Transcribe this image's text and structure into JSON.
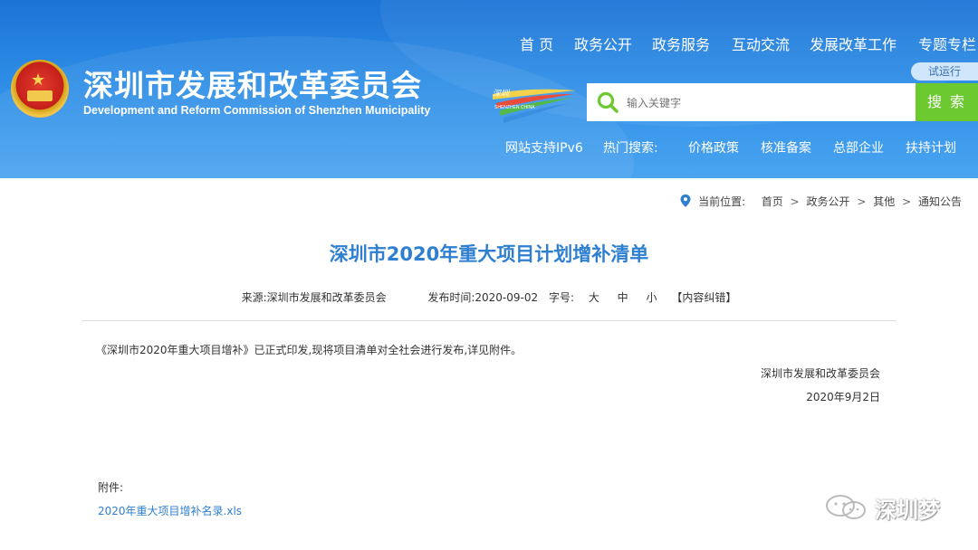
{
  "header": {
    "title_cn": "深圳市发展和改革委员会",
    "title_en": "Development and Reform Commission of Shenzhen Municipality",
    "emblem_icon": "national-emblem-icon",
    "nav": [
      "首 页",
      "政务公开",
      "政务服务",
      "互动交流",
      "发展改革工作",
      "专题专栏"
    ],
    "trial_badge": "试运行",
    "sz_logo_text": "SHENZHEN CHINA",
    "search": {
      "placeholder": "输入关键字",
      "button": "搜 索",
      "icon": "search-icon"
    },
    "ipv6": "网站支持IPv6",
    "hot_label": "热门搜索:",
    "hot_links": [
      "价格政策",
      "核准备案",
      "总部企业",
      "扶持计划"
    ],
    "colors": {
      "header_blue": "#2d8de6",
      "search_green": "#6cc92f",
      "title_blue": "#2f7fd0"
    }
  },
  "breadcrumb": {
    "label": "当前位置:",
    "items": [
      "首页",
      "政务公开",
      "其他",
      "通知公告"
    ],
    "separator": ">"
  },
  "article": {
    "title": "深圳市2020年重大项目计划增补清单",
    "source": "来源:深圳市发展和改革委员会",
    "date": "发布时间:2020-09-02",
    "font_label": "字号:",
    "font_sizes": [
      "大",
      "中",
      "小"
    ],
    "correction": "【内容纠错】",
    "paragraph": "《深圳市2020年重大项目增补》已正式印发,现将项目清单对全社会进行发布,详见附件。",
    "signature": "深圳市发展和改革委员会",
    "sign_date": "2020年9月2日",
    "attachment_label": "附件:",
    "attachment_link": "2020年重大项目增补名录.xls"
  },
  "watermark": {
    "text": "深圳梦",
    "icon": "wechat-icon"
  }
}
